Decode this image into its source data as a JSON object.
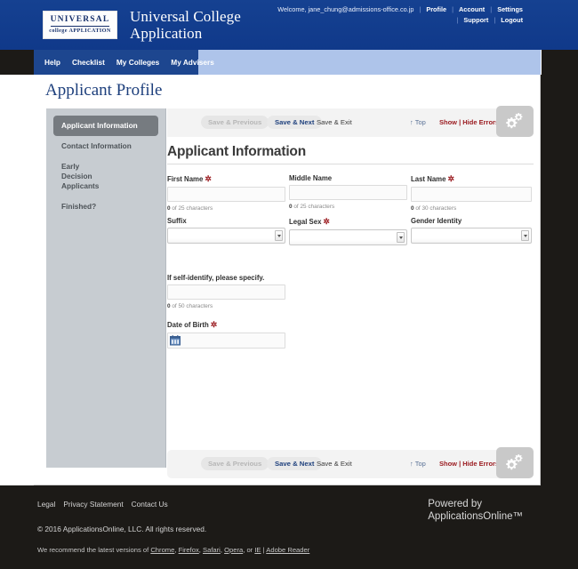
{
  "header": {
    "logo": {
      "line1": "UNIVERSAL",
      "line2": "college APPLICATION"
    },
    "brand_title_line1": "Universal College",
    "brand_title_line2": "Application",
    "welcome": "Welcome, jane_chung@admissions-office.co.jp",
    "links_row1": [
      "Profile",
      "Account",
      "Settings"
    ],
    "links_row2": [
      "Support",
      "Logout"
    ]
  },
  "nav": {
    "items": [
      "Help",
      "Checklist",
      "My Colleges",
      "My Advisers"
    ]
  },
  "page": {
    "title": "Applicant Profile",
    "section_title": "Applicant Information"
  },
  "sidebar": {
    "items": [
      {
        "label": "Applicant Information",
        "active": true
      },
      {
        "label": "Contact Information",
        "active": false
      },
      {
        "label": "Early Decision Applicants",
        "active": false
      },
      {
        "label": "Finished?",
        "active": false
      }
    ]
  },
  "toolbar": {
    "save_previous": "Save & Previous",
    "save_next": "Save & Next",
    "save_exit": "Save & Exit",
    "top": "↑ Top",
    "errors": "Show | Hide Errors",
    "gear_icon": "gear-icon"
  },
  "form": {
    "required_marker": "✲",
    "row1": [
      {
        "label": "First Name",
        "required": true,
        "value": "",
        "counter_num": "0",
        "counter_text": " of 25 characters"
      },
      {
        "label": "Middle Name",
        "required": false,
        "value": "",
        "counter_num": "0",
        "counter_text": " of 25 characters"
      },
      {
        "label": "Last Name",
        "required": true,
        "value": "",
        "counter_num": "0",
        "counter_text": " of 30 characters"
      }
    ],
    "row2": [
      {
        "label": "Suffix",
        "required": false,
        "value": ""
      },
      {
        "label": "Legal Sex",
        "required": true,
        "value": ""
      },
      {
        "label": "Gender Identity",
        "required": false,
        "value": ""
      }
    ],
    "self_identify": {
      "label": "If self-identify, please specify.",
      "value": "",
      "counter_num": "0",
      "counter_text": " of 50 characters"
    },
    "dob": {
      "label": "Date of Birth",
      "required": true,
      "value": "",
      "icon": "calendar-icon"
    }
  },
  "footer": {
    "links": [
      "Legal",
      "Privacy Statement",
      "Contact Us"
    ],
    "copyright": "© 2016 ApplicationsOnline, LLC. All rights reserved.",
    "recommend_prefix": "We recommend the latest versions of ",
    "browsers": [
      "Chrome",
      "Firefox",
      "Safari",
      "Opera"
    ],
    "recommend_mid": ", or ",
    "ie": "IE",
    "recommend_sep": " | ",
    "adobe": "Adobe Reader",
    "powered_line1": "Powered by",
    "powered_line2": "ApplicationsOnline™"
  },
  "colors": {
    "header_blue": "#164194",
    "nav_dark": "#1d468f",
    "nav_light": "#aec4ea",
    "sidebar_gray": "#c7ccd1",
    "active_gray": "#767b80",
    "error_red": "#9b1c21",
    "title_navy": "#1d3f7c",
    "footer_dark": "#1c1a17"
  }
}
